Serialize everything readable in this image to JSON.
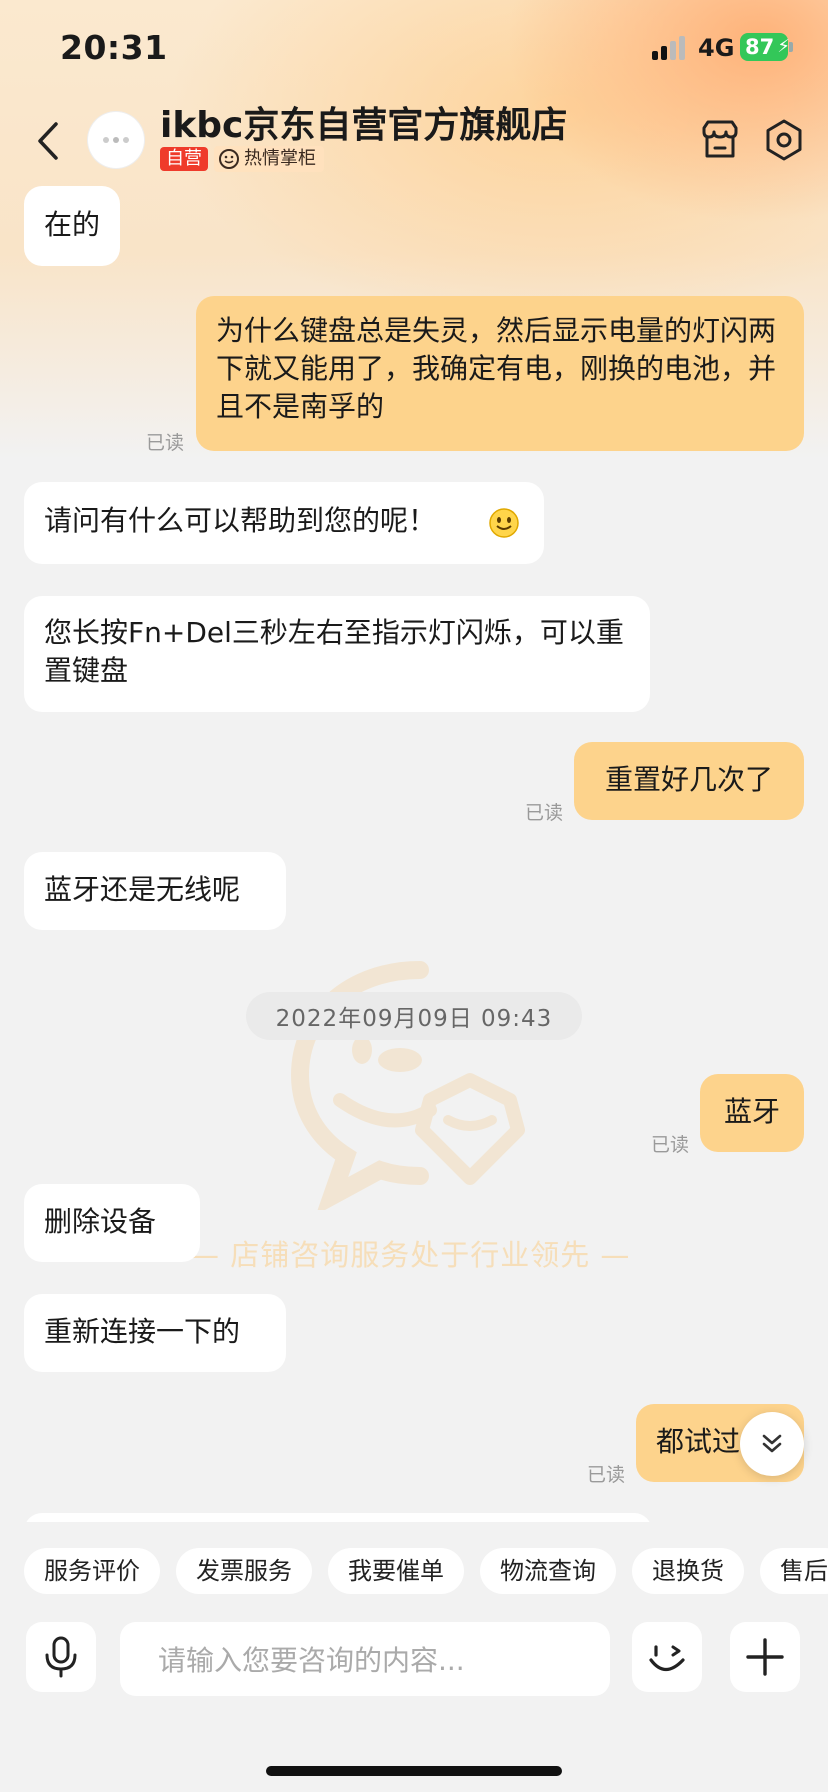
{
  "status_bar": {
    "time": "20:31",
    "network": "4G",
    "battery": "87"
  },
  "header": {
    "shop_name": "ikbc京东自营官方旗舰店",
    "tag_self": "自营",
    "tag_hot": "热情掌柜"
  },
  "messages": {
    "m1": "在的",
    "m2": "为什么键盘总是失灵，然后显示电量的灯闪两下就又能用了，我确定有电，刚换的电池，并且不是南孚的",
    "m3": "请问有什么可以帮助到您的呢！",
    "m4": "您长按Fn+Del三秒左右至指示灯闪烁，可以重置键盘",
    "m5": "重置好几次了",
    "m6": "蓝牙还是无线呢",
    "m7": "蓝牙",
    "m8": "删除设备",
    "m9": "重新连接一下的",
    "m10": "都试过"
  },
  "read_label": "已读",
  "timestamp": "2022年09月09日 09:43",
  "watermark_text": "—  店铺咨询服务处于行业领先  —",
  "quick_actions": [
    "服务评价",
    "发票服务",
    "我要催单",
    "物流查询",
    "退换货",
    "售后"
  ],
  "input": {
    "placeholder": "请输入您要咨询的内容..."
  },
  "colors": {
    "user_bubble": "#fdd38c",
    "self_tag": "#ef3b2b",
    "battery": "#33c759"
  }
}
